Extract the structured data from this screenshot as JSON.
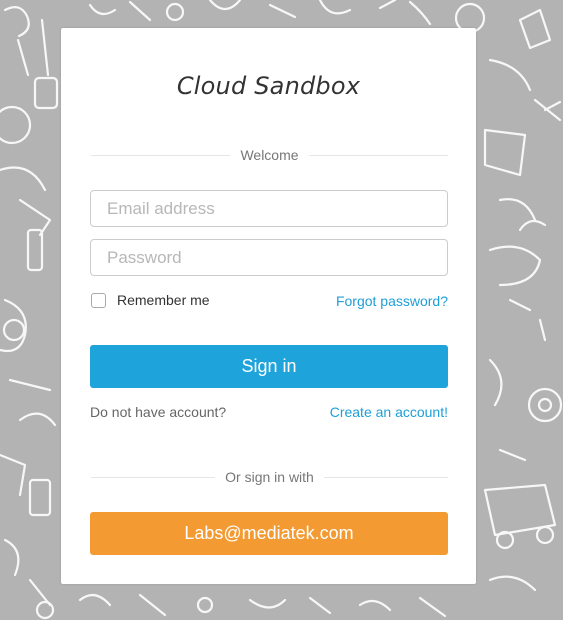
{
  "app": {
    "title": "Cloud Sandbox",
    "welcome_label": "Welcome"
  },
  "form": {
    "email_placeholder": "Email address",
    "email_value": "",
    "password_placeholder": "Password",
    "password_value": "",
    "remember_label": "Remember me",
    "remember_checked": false,
    "forgot_link": "Forgot password?",
    "signin_label": "Sign in",
    "no_account_text": "Do not have account?",
    "create_account_link": "Create an account!",
    "alt_signin_label": "Or sign in with",
    "labs_button_label": "Labs@mediatek.com"
  },
  "colors": {
    "background": "#b3b3b3",
    "signin_button": "#1ea3db",
    "labs_button": "#f39b32",
    "link": "#1e9fd7"
  },
  "icons": {
    "background": "doodle-pattern",
    "checkbox": "checkbox-unchecked"
  }
}
